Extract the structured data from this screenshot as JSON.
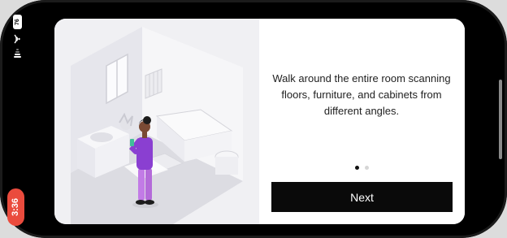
{
  "status_bar": {
    "battery_level": "76",
    "time": "3:36",
    "icons": [
      "battery-icon",
      "wifi-icon",
      "cellular-signal-icon"
    ]
  },
  "onboarding": {
    "illustration": "room-scanning-illustration",
    "instruction": "Walk around the entire room scanning floors, furniture, and cabinets from different angles.",
    "page_indicator": {
      "current": 1,
      "total": 2
    },
    "next_label": "Next"
  },
  "colors": {
    "button_bg": "#0a0a0a",
    "time_pill": "#ea4b3d",
    "figure_shirt": "#8a3fd1",
    "figure_pants": "#c27be6"
  }
}
